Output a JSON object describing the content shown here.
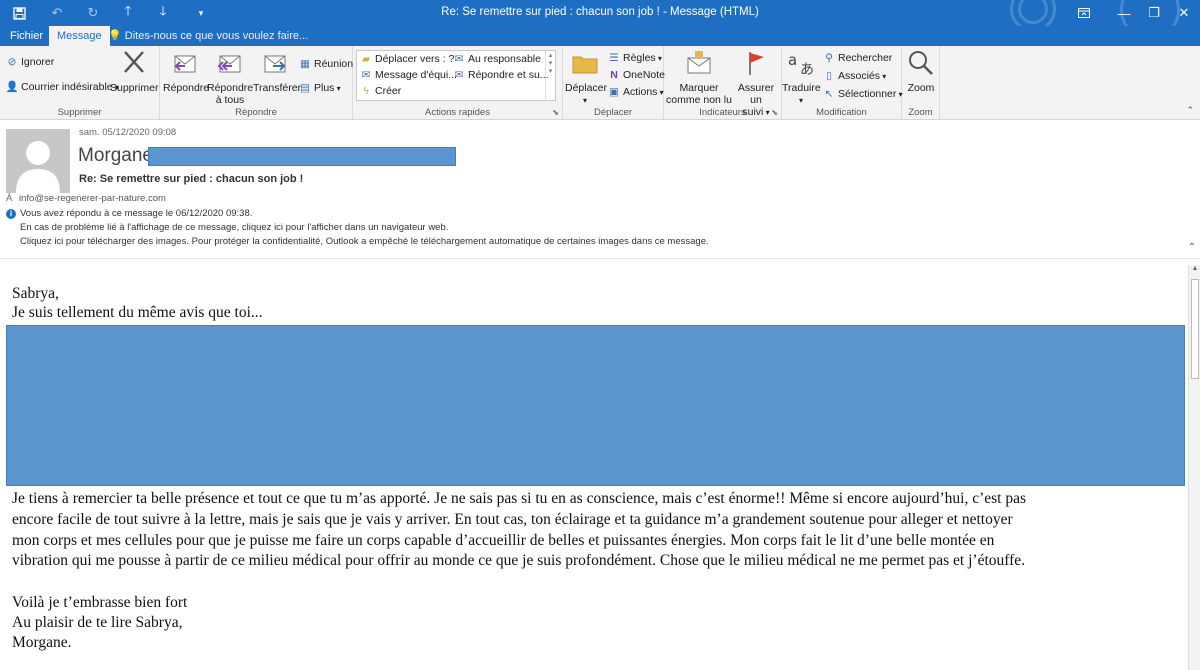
{
  "window": {
    "title": "Re: Se remettre sur pied : chacun son job ! - Message (HTML)"
  },
  "tabs": [
    {
      "label": "Fichier"
    },
    {
      "label": "Message"
    }
  ],
  "tell_me": "Dites-nous ce que vous voulez faire...",
  "ribbon": {
    "supprimer": {
      "ignorer": "Ignorer",
      "courrier_indesirable": "Courrier indésirable",
      "supprimer_btn": "Supprimer",
      "label": "Supprimer"
    },
    "repondre": {
      "repondre": "Répondre",
      "repondre_tous_1": "Répondre",
      "repondre_tous_2": "à tous",
      "transferer": "Transférer",
      "reunion": "Réunion",
      "plus": "Plus",
      "label": "Répondre"
    },
    "actions_rapides": {
      "items": [
        "Déplacer vers : ?",
        "Au responsable",
        "Message d'équi...",
        "Répondre et su...",
        "Créer"
      ],
      "label": "Actions rapides"
    },
    "deplacer": {
      "deplacer": "Déplacer",
      "regles": "Règles",
      "onenote": "OneNote",
      "actions": "Actions",
      "label": "Déplacer"
    },
    "indicateurs": {
      "marquer_1": "Marquer",
      "marquer_2": "comme non lu",
      "assurer_1": "Assurer un",
      "assurer_2": "suivi",
      "label": "Indicateurs"
    },
    "modification": {
      "traduire": "Traduire",
      "rechercher": "Rechercher",
      "associes": "Associés",
      "selectionner": "Sélectionner",
      "label": "Modification"
    },
    "zoom": {
      "zoom": "Zoom",
      "label": "Zoom"
    }
  },
  "message": {
    "date": "sam. 05/12/2020 09:08",
    "sender": "Morgane",
    "subject": "Re: Se remettre sur pied : chacun son job !",
    "to_label": "À",
    "to": "info@se-regenerer-par-nature.com",
    "info_lines": [
      "Vous avez répondu à ce message le 06/12/2020 09:38.",
      "En cas de problème lié à l'affichage de ce message, cliquez ici pour l'afficher dans un navigateur web.",
      "Cliquez ici pour télécharger des images. Pour protéger la confidentialité, Outlook a empêché le téléchargement automatique de certaines images dans ce message."
    ]
  },
  "body": {
    "greeting": "Sabrya,",
    "line1": "Je suis tellement du même avis que toi...",
    "para": [
      "Je tiens à remercier ta belle présence et tout ce que tu m’as apporté. Je ne sais pas si tu en as conscience, mais c’est énorme!! Même si encore aujourd’hui, c’est pas",
      "encore facile de tout suivre à la lettre, mais je sais que je vais y arriver. En tout cas, ton éclairage et ta guidance m’a grandement soutenue pour alleger et nettoyer",
      "mon corps et mes cellules pour que je puisse me faire un corps capable d’accueillir de belles et puissantes énergies. Mon corps fait le lit d’une belle montée en",
      "vibration qui me pousse à partir de ce milieu médical pour offrir au monde ce que je suis profondément. Chose que le milieu médical ne me permet pas et j’étouffe."
    ],
    "closing": [
      "Voilà je t’embrasse bien fort",
      "Au plaisir de te lire Sabrya,",
      "Morgane."
    ]
  },
  "colors": {
    "titlebar": "#1e6fc4",
    "ribbon": "#f3f3f3",
    "redaction": "#5b95d0"
  }
}
